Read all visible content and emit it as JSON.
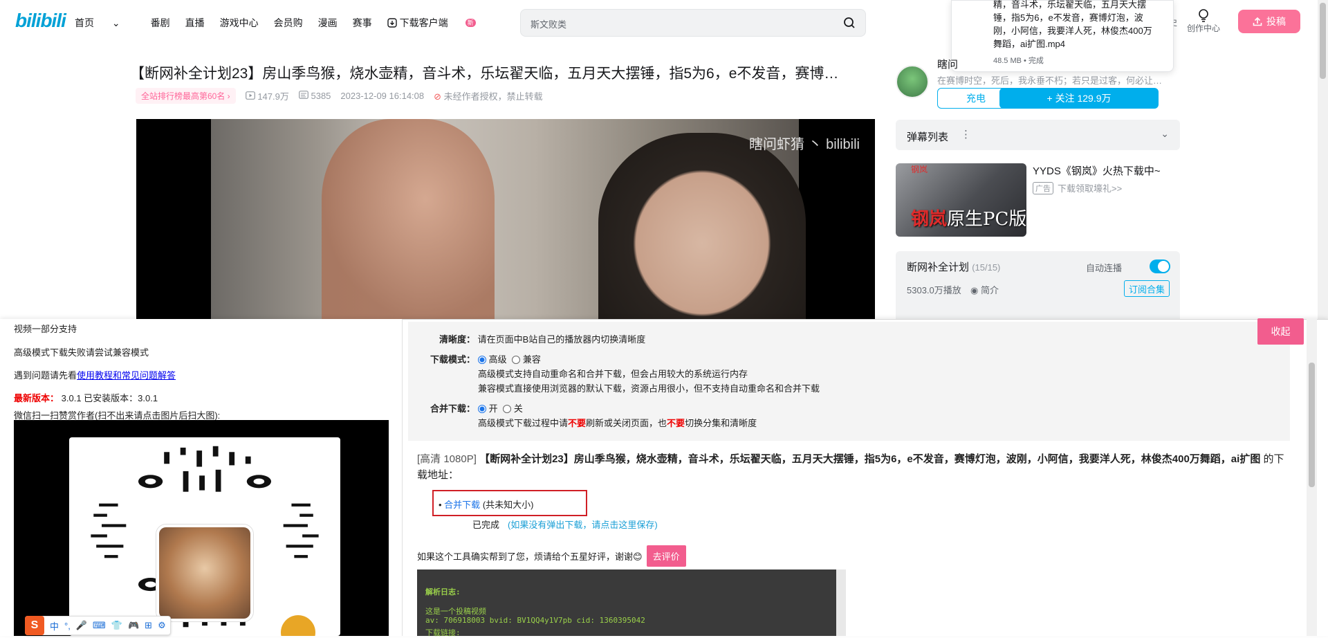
{
  "header": {
    "logo": "bilibili",
    "nav": [
      "首页",
      "番剧",
      "直播",
      "游戏中心",
      "会员购",
      "漫画",
      "赛事",
      "下载客户端"
    ],
    "nav_home_suffix": "⌄",
    "new_badge": "新",
    "search_placeholder": "斯文败类",
    "right_items": [
      "史",
      "创作中心"
    ],
    "upload_label": "投稿"
  },
  "download_popup": {
    "filename": "精，音斗术，乐坛翟天临，五月天大摆锤，指5为6，e不发音，赛博灯泡，波刚，小阿信，我要洋人死，林俊杰400万舞蹈，ai扩图.mp4",
    "meta": "48.5 MB • 完成"
  },
  "video": {
    "title": "【断网补全计划23】房山季鸟猴，烧水壶精，音斗术，乐坛翟天临，五月天大摆锤，指5为6，e不发音，赛博…",
    "rank": "全站排行榜最高第60名 ›",
    "views": "147.9万",
    "danmaku_count": "5385",
    "date": "2023-12-09 16:14:08",
    "no_repost": "未经作者授权，禁止转载",
    "watermark": "瞎问虾猜 丶 bilibili"
  },
  "uploader": {
    "name": "瞎问",
    "desc": "在赛博时空，死后，我永垂不朽；若只是过客，何必让…",
    "charge": "充电",
    "follow": "+ 关注 129.9万"
  },
  "danmaku_list": {
    "label": "弹幕列表",
    "more": "⋮",
    "chevron": "⌄"
  },
  "ad": {
    "corner": "钢岚",
    "image_text_red": "钢岚",
    "image_text": "原生PC版",
    "title": "YYDS《钢岚》火热下载中~",
    "tag": "广告",
    "sub": "下载领取壕礼>>"
  },
  "playlist": {
    "title": "断网补全计划",
    "count": "(15/15)",
    "autoplay": "自动连播",
    "plays": "5303.0万播放",
    "intro": "简介",
    "subscribe": "订阅合集"
  },
  "left_panel": {
    "partial": "视频一部分支持",
    "tip_compat": "高级模式下载失败请尝试兼容模式",
    "faq_prefix": "遇到问题请先看",
    "faq_link": "使用教程和常见问题解答",
    "version_label": "最新版本：",
    "version_text": "3.0.1 已安装版本：3.0.1",
    "donate": "微信扫一扫赞赏作者(扫不出来请点击图片后扫大图):",
    "ime_items": [
      "S",
      "中",
      "°,",
      "🎤",
      "⌨",
      "👕",
      "🎮",
      "⊞",
      "⚙"
    ]
  },
  "settings": {
    "clarity_label": "清晰度：",
    "clarity_text": "请在页面中B站自己的播放器内切换清晰度",
    "mode_label": "下载模式：",
    "mode_advanced": "高级",
    "mode_compat": "兼容",
    "mode_desc1": "高级模式支持自动重命名和合并下载，但会占用较大的系统运行内存",
    "mode_desc2": "兼容模式直接使用浏览器的默认下载，资源占用很小，但不支持自动重命名和合并下载",
    "merge_label": "合并下载：",
    "merge_on": "开",
    "merge_off": "关",
    "merge_desc_a": "高级模式下载过程中请",
    "merge_desc_b": "不要",
    "merge_desc_c": "刷新或关闭页面，也",
    "merge_desc_d": "不要",
    "merge_desc_e": "切换分集和清晰度",
    "collapse": "收起"
  },
  "result": {
    "quality": "[高清 1080P]",
    "title": "【断网补全计划23】房山季鸟猴，烧水壶精，音斗术，乐坛翟天临，五月天大摆锤，指5为6，e不发音，赛博灯泡，波刚，小阿信，我要洋人死，林俊杰400万舞蹈，ai扩图",
    "suffix": "的下载地址：",
    "merge_link": "合并下载",
    "merge_size": "(共未知大小)",
    "done": "已完成",
    "save_hint": "(如果没有弹出下载，请点击这里保存)",
    "rate_text": "如果这个工具确实帮到了您，烦请给个五星好评，谢谢😊",
    "rate_btn": "去评价"
  },
  "log": {
    "title": "解析日志:",
    "line1": "这是一个投稿视频",
    "line2": "av: 706918003 bvid: BV1QQ4y1V7pb cid: 1360395042",
    "line3": "下载链接:"
  },
  "colors": {
    "brand_blue": "#00aeec",
    "pink": "#fb7299",
    "red": "#d01f25"
  }
}
